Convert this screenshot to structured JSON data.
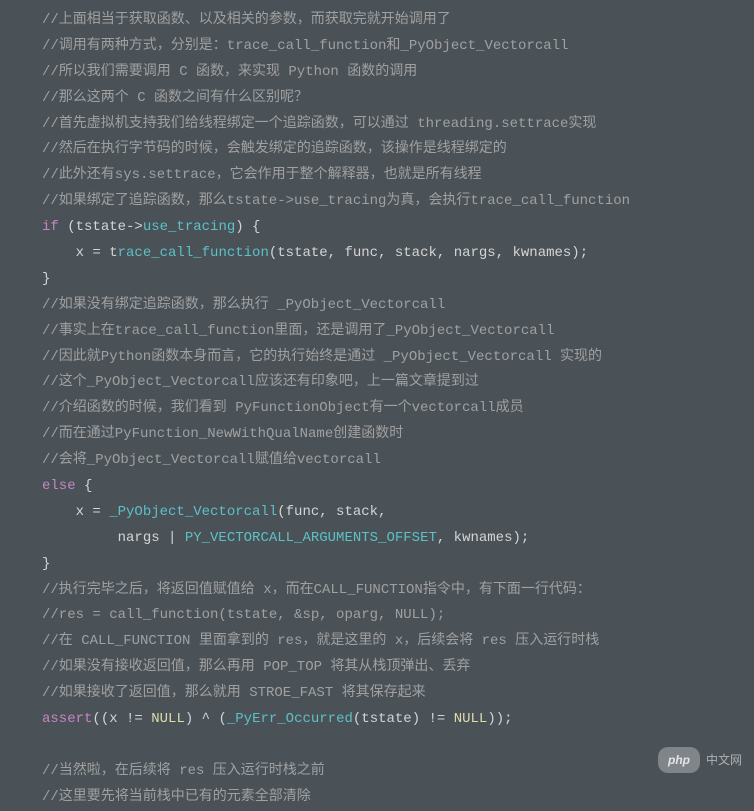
{
  "code": {
    "c1": "//上面相当于获取函数、以及相关的参数，而获取完就开始调用了",
    "c2": "//调用有两种方式，分别是：trace_call_function和_PyObject_Vectorcall",
    "c3": "//所以我们需要调用 C 函数，来实现 Python 函数的调用",
    "c4": "//那么这两个 C 函数之间有什么区别呢？",
    "c5": "//首先虚拟机支持我们给线程绑定一个追踪函数，可以通过 threading.settrace实现",
    "c6": "//然后在执行字节码的时候，会触发绑定的追踪函数，该操作是线程绑定的",
    "c7": "//此外还有sys.settrace，它会作用于整个解释器，也就是所有线程",
    "c8": "//如果绑定了追踪函数，那么tstate->use_tracing为真，会执行trace_call_function",
    "if_kw": "if",
    "if_cond_open": " (tstate->",
    "use_tracing": "use_tracing",
    "if_cond_close": ") {",
    "assign1_pre": "    x = t",
    "trace_call": "race_call_function",
    "assign1_args": "(tstate, func, stack, nargs, kwnames);",
    "brace1": "}",
    "c9": "//如果没有绑定追踪函数，那么执行 _PyObject_Vectorcall",
    "c10": "//事实上在trace_call_function里面，还是调用了_PyObject_Vectorcall",
    "c11": "//因此就Python函数本身而言，它的执行始终是通过 _PyObject_Vectorcall 实现的",
    "c12": "//这个_PyObject_Vectorcall应该还有印象吧，上一篇文章提到过",
    "c13": "//介绍函数的时候，我们看到 PyFunctionObject有一个vectorcall成员",
    "c14": "//而在通过PyFunction_NewWithQualName创建函数时",
    "c15": "//会将_PyObject_Vectorcall赋值给vectorcall",
    "else_kw": "else",
    "else_open": " {",
    "assign2_pre": "    x = ",
    "vectorcall": "_PyObject_Vectorcall",
    "assign2_args": "(func, stack,",
    "assign2_line2_pre": "         nargs | ",
    "offset_macro": "PY_VECTORCALL_ARGUMENTS_OFFSET",
    "assign2_line2_post": ", kwnames);",
    "brace2": "}",
    "c16": "//执行完毕之后，将返回值赋值给 x，而在CALL_FUNCTION指令中，有下面一行代码：",
    "c17": "//res = call_function(tstate, &sp, oparg, NULL);",
    "c18": "//在 CALL_FUNCTION 里面拿到的 res，就是这里的 x，后续会将 res 压入运行时栈",
    "c19": "//如果没有接收返回值，那么再用 POP_TOP 将其从栈顶弹出、丢弃",
    "c20": "//如果接收了返回值，那么就用 STROE_FAST 将其保存起来",
    "assert_kw": "assert",
    "assert_open": "((x != ",
    "null1": "NULL",
    "assert_mid": ") ^ (",
    "err_occ": "_PyErr_Occurred",
    "assert_args": "(tstate) != ",
    "null2": "NULL",
    "assert_close": "));",
    "c21": "//当然啦，在后续将 res 压入运行时栈之前",
    "c22": "//这里要先将当前栈中已有的元素全部清除"
  },
  "watermark": {
    "pill": "php",
    "text": "中文网"
  }
}
